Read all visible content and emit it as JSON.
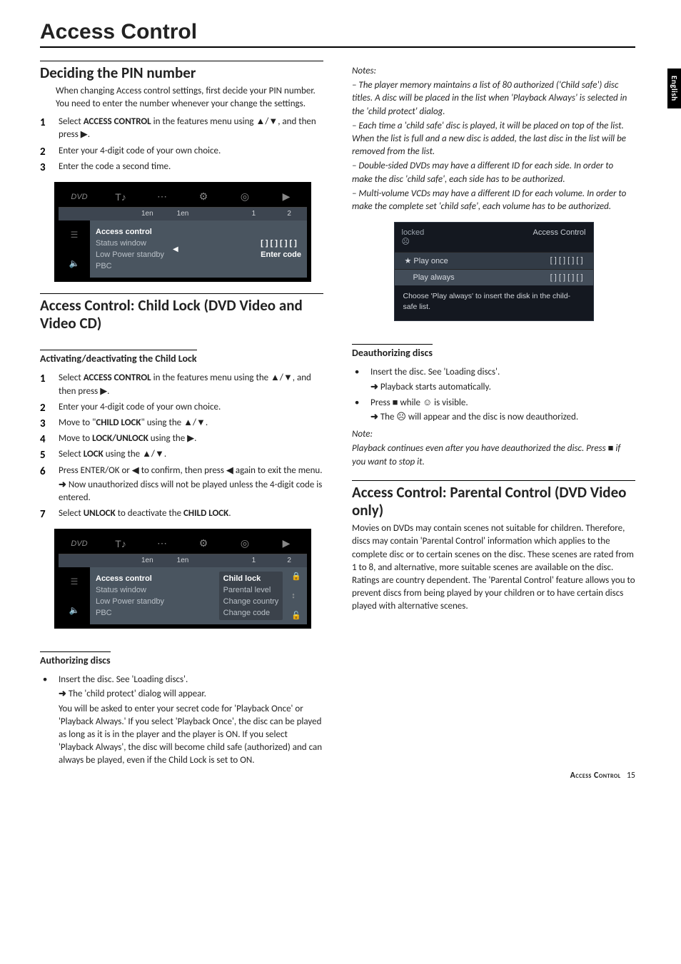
{
  "language_tab": "English",
  "page_title": "Access Control",
  "footer": {
    "title": "Access Control",
    "page": "15"
  },
  "left": {
    "sec1": {
      "heading": "Deciding the PIN number",
      "intro": "When changing Access control settings, first decide your PIN number. You need to enter the number whenever your change the settings.",
      "steps": {
        "s1a": "Select ",
        "s1b": "ACCESS CONTROL",
        "s1c": " in the features menu using ▲/▼, and then press ▶.",
        "s2": "Enter your 4-digit code of your own choice.",
        "s3": "Enter the code a second time."
      }
    },
    "osd1": {
      "tabs": {
        "dvd": "DVD",
        "sub1": "1en",
        "sub2": "1en",
        "sub3": "1",
        "sub4": "2"
      },
      "left_icons": {
        "a": "☰",
        "b": "🔈"
      },
      "menu": {
        "i1": "Access control",
        "i2": "Status window",
        "i3": "Low Power standby",
        "i4": "PBC"
      },
      "right": {
        "caret": "◀",
        "code": "[ ] [ ] [ ] [ ]",
        "enter": "Enter code"
      }
    },
    "sec2": {
      "heading": "Access Control: Child Lock (DVD Video and Video CD)",
      "sub1": "Activating/deactivating the Child Lock",
      "steps": {
        "s1a": "Select ",
        "s1b": "ACCESS CONTROL",
        "s1c": " in the features menu using the ▲/▼, and then press ▶.",
        "s2": "Enter your 4-digit code of your own choice.",
        "s3a": "Move to \"",
        "s3b": "CHILD LOCK",
        "s3c": "\" using the ▲/▼.",
        "s4a": "Move to ",
        "s4b": "LOCK/UNLOCK",
        "s4c": " using the ▶.",
        "s5a": "Select ",
        "s5b": "LOCK",
        "s5c": " using the ▲/▼.",
        "s6": "Press ENTER/OK or ◀ to confirm, then press ◀ again to exit the menu.",
        "s6r": "Now unauthorized discs will not be played unless the 4-digit code is entered.",
        "s7a": "Select ",
        "s7b": "UNLOCK",
        "s7c": " to deactivate the ",
        "s7d": "CHILD LOCK",
        "s7e": "."
      }
    },
    "osd2": {
      "tabs": {
        "dvd": "DVD",
        "sub1": "1en",
        "sub2": "1en",
        "sub3": "1",
        "sub4": "2"
      },
      "left_icons": {
        "a": "☰",
        "b": "🔈"
      },
      "menu": {
        "i1": "Access control",
        "i2": "Status window",
        "i3": "Low Power standby",
        "i4": "PBC"
      },
      "submenu": {
        "r1": "Child lock",
        "r2": "Parental level",
        "r3": "Change country",
        "r4": "Change code"
      },
      "icons": {
        "lock": "🔒",
        "arrows": "↕",
        "unlock": "🔓"
      }
    },
    "sub_auth": {
      "heading": "Authorizing discs",
      "b1": "Insert the disc. See 'Loading discs'.",
      "r1": "The 'child protect' dialog will appear.",
      "p1": "You will be asked to enter your secret code for 'Playback Once' or 'Playback Always.' If you select 'Playback Once', the disc can be played as long as it is in the player and the player is ON. If you select 'Playback Always', the disc will become child safe (authorized) and can always be played, even if the Child Lock is set to ON."
    }
  },
  "right": {
    "notes": {
      "h": "Notes:",
      "n1": "–  The player memory maintains a list of 80 authorized ('Child safe') disc titles. A disc will be placed in the list when 'Playback Always' is selected in the 'child protect' dialog.",
      "n2": "–  Each time a 'child safe' disc is played, it will be placed on top of the list. When the list is full and a new disc is added, the last disc in the list will be removed from the list.",
      "n3": "–  Double-sided DVDs may have a different ID for each side. In order to make the disc 'child safe', each side has to be authorized.",
      "n4": "–  Multi-volume VCDs may have a different ID for each volume. In order to make the complete set 'child safe', each volume has to be authorized."
    },
    "dialog": {
      "locked": "locked",
      "face": "☹",
      "title": "Access Control",
      "row1l": "Play once",
      "row1r": "[ ]  [ ]  [ ]  [ ]",
      "row2l": "Play always",
      "row2r": "[ ]  [ ]  [ ]  [ ]",
      "foot": "Choose 'Play always' to insert the disk in the child-safe list."
    },
    "deauth": {
      "heading": "Deauthorizing discs",
      "b1": "Insert the disc. See 'Loading discs'.",
      "r1": "Playback starts automatically.",
      "b2": "Press ■ while ☺ is visible.",
      "r2": "The ☹ will appear and the disc is now deauthorized.",
      "noteh": "Note:",
      "note": "Playback continues even after you have deauthorized the disc. Press ■ if you want to stop it."
    },
    "parental": {
      "heading": "Access Control: Parental Control (DVD Video only)",
      "p1": "Movies on DVDs may contain scenes not suitable for children. Therefore, discs may contain 'Parental Control' information which applies to the complete disc or to certain scenes on the disc. These scenes are rated from 1 to 8, and alternative, more suitable scenes are available on the disc. Ratings are country dependent. The 'Parental Control' feature allows you to prevent discs from being played by your children or to have certain discs played with alternative scenes."
    }
  }
}
